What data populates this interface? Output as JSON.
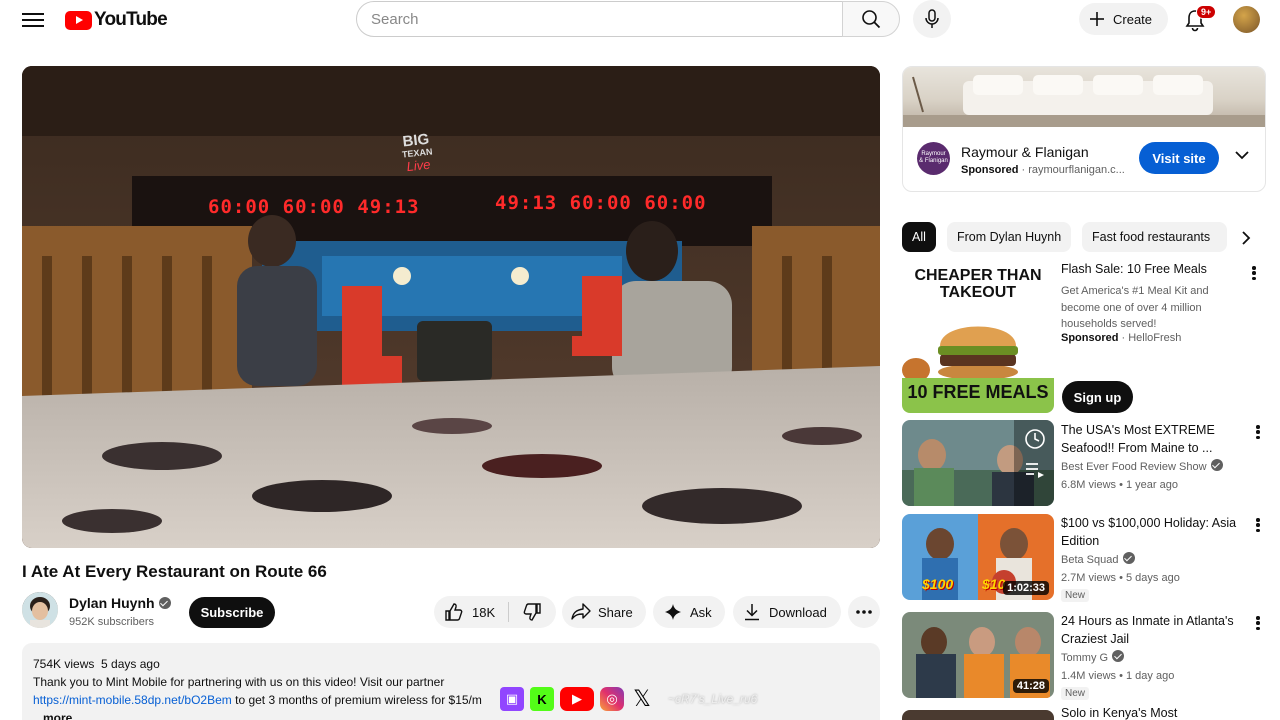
{
  "header": {
    "logo_text": "YouTube",
    "search_placeholder": "Search",
    "create_label": "Create",
    "notification_count": "9+"
  },
  "video": {
    "title": "I Ate At Every Restaurant on Route 66",
    "channel_name": "Dylan Huynh",
    "subscribers": "952K subscribers",
    "subscribe_label": "Subscribe",
    "likes": "18K",
    "share_label": "Share",
    "ask_label": "Ask",
    "download_label": "Download",
    "scene_text": {
      "sign_big": "BIG",
      "sign_texan": "TEXAN",
      "sign_live": "Live",
      "timer_1": "60:00",
      "timer_2": "60:00",
      "timer_3": "49:13",
      "timer_4": "49:13",
      "timer_5": "60:00",
      "timer_6": "60:00"
    }
  },
  "description": {
    "views": "754K views",
    "date": "5 days ago",
    "line1": "Thank you to Mint Mobile for partnering with us on this video! Visit our partner",
    "link": "https://mint-mobile.58dp.net/bO2Bem",
    "line2_rest": " to get 3 months of premium wireless for $15/m",
    "more": "...more"
  },
  "overlay": {
    "handle": "~cR7's_Live_ru6"
  },
  "ad": {
    "logo_line1": "Raymour",
    "logo_line2": "& Flanigan",
    "name": "Raymour & Flanigan",
    "sponsored": "Sponsored",
    "domain": "raymourflanigan.c...",
    "visit_label": "Visit site"
  },
  "chips": [
    {
      "label": "All",
      "active": true
    },
    {
      "label": "From Dylan Huynh",
      "active": false
    },
    {
      "label": "Fast food restaurants",
      "active": false
    }
  ],
  "promo": {
    "thumb_headline_1": "CHEAPER THAN",
    "thumb_headline_2": "TAKEOUT",
    "thumb_footer": "10 FREE MEALS",
    "title": "Flash Sale: 10 Free Meals",
    "description": "Get America's #1 Meal Kit and become one of over 4 million households served!",
    "sponsored": "Sponsored",
    "advertiser": "HelloFresh",
    "cta": "Sign up"
  },
  "recommendations": [
    {
      "title": "The USA's Most EXTREME Seafood!! From Maine to ...",
      "channel": "Best Ever Food Review Show",
      "verified": true,
      "views": "6.8M views",
      "age": "1 year ago",
      "duration": "",
      "new": ""
    },
    {
      "title": "$100 vs $100,000 Holiday: Asia Edition",
      "channel": "Beta Squad",
      "verified": true,
      "views": "2.7M views",
      "age": "5 days ago",
      "duration": "1:02:33",
      "new": "New",
      "thumb_tag_1": "$100",
      "thumb_tag_2": "$10"
    },
    {
      "title": "24 Hours as Inmate in Atlanta's Craziest Jail",
      "channel": "Tommy G",
      "verified": true,
      "views": "1.4M views",
      "age": "1 day ago",
      "duration": "41:28",
      "new": "New"
    },
    {
      "title": "Solo in Kenya's Most Dangerous"
    }
  ],
  "colors": {
    "brand_red": "#ff0000",
    "accent_blue": "#065fd4",
    "text_primary": "#0f0f0f",
    "text_secondary": "#606060",
    "chip_bg": "#f2f2f2"
  }
}
